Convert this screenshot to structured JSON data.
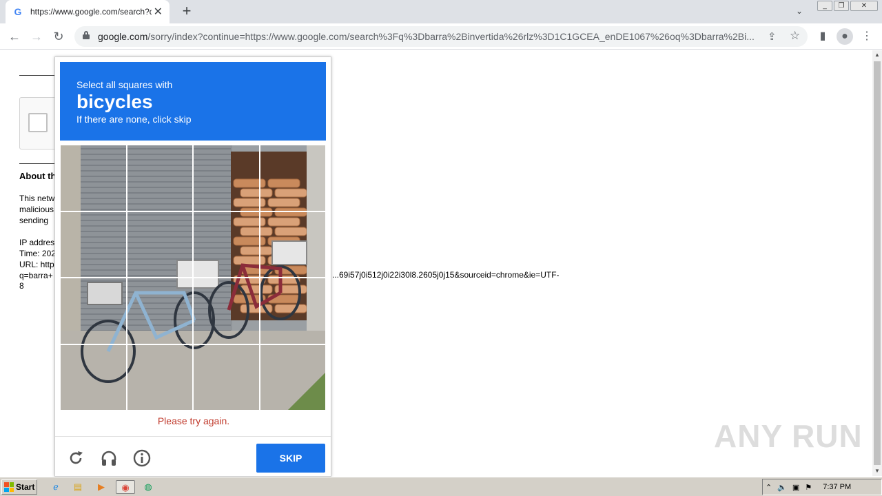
{
  "browser": {
    "tab_title": "https://www.google.com/search?q=",
    "favicon": "G",
    "new_tab": "+",
    "address_host": "google.com",
    "address_path": "/sorry/index?continue=https://www.google.com/search%3Fq%3Dbarra%2Binvertida%26rlz%3D1C1GCEA_enDE1067%26oq%3Dbarra%2Bi..."
  },
  "page": {
    "about_heading": "About this page",
    "paragraph_lines": [
      "This network",
      "malicious",
      "sending"
    ],
    "ip_lines": [
      "IP address:",
      "Time: 2023",
      "URL: https://",
      "q=barra+"
    ],
    "url_tail": "...69i57j0i512j0i22i30l8.2605j0j15&sourceid=chrome&ie=UTF-",
    "url_tail2": "8"
  },
  "challenge": {
    "instruction_line1": "Select all squares with",
    "target_object": "bicycles",
    "instruction_line3": "If there are none, click skip",
    "error_message": "Please try again.",
    "skip_label": "SKIP",
    "colors": {
      "header": "#1a73e8",
      "error": "#c0392b"
    }
  },
  "watermark": "ANY RUN",
  "taskbar": {
    "start_label": "Start",
    "clock": "7:37 PM"
  }
}
